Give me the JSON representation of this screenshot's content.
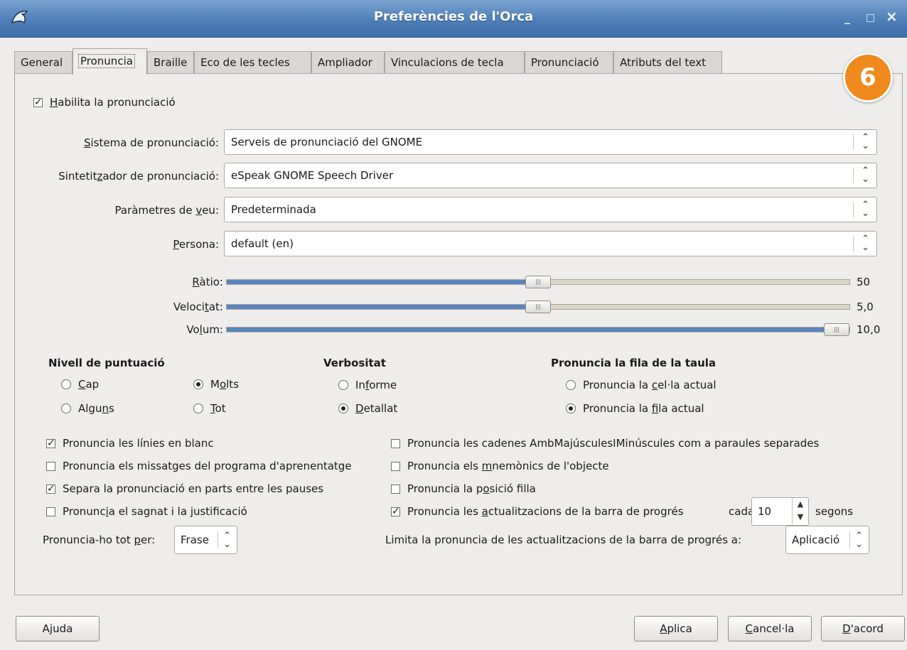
{
  "window": {
    "title": "Preferències de l'Orca",
    "minimize": "_",
    "maximize": "□",
    "close": "×"
  },
  "tabs": [
    "General",
    "Pronuncia",
    "Braille",
    "Eco de les tecles",
    "Ampliador",
    "Vinculacions de tecla",
    "Pronunciació",
    "Atributs del text"
  ],
  "badge": "6",
  "enable_speech": {
    "pre": "",
    "ul": "H",
    "post": "abilita la pronunciació",
    "checked": true
  },
  "fields": {
    "system": {
      "pre": "",
      "ul": "S",
      "post": "istema de pronunciació:",
      "value": "Serveis de pronunciació del GNOME"
    },
    "synth": {
      "pre": "Sintetit",
      "ul": "z",
      "post": "ador de pronunciació:",
      "value": "eSpeak GNOME Speech Driver"
    },
    "voice": {
      "pre": "Paràmetres de ",
      "ul": "v",
      "post": "eu:",
      "value": "Predeterminada"
    },
    "person": {
      "pre": "",
      "ul": "P",
      "post": "ersona:",
      "value": "default (en)"
    }
  },
  "sliders": {
    "rate": {
      "pre": "",
      "ul": "R",
      "post": "àtio:",
      "value": "50",
      "fraction": 0.5
    },
    "pitch": {
      "pre": "Veloci",
      "ul": "t",
      "post": "at:",
      "value": "5,0",
      "fraction": 0.5
    },
    "volume": {
      "pre": "Vo",
      "ul": "l",
      "post": "um:",
      "value": "10,0",
      "fraction": 1.0
    }
  },
  "punct": {
    "header": "Nivell de puntuació",
    "none": {
      "pre": "",
      "ul": "C",
      "post": "ap",
      "selected": false
    },
    "most": {
      "pre": "M",
      "ul": "o",
      "post": "lts",
      "selected": true
    },
    "some": {
      "pre": "Algu",
      "ul": "n",
      "post": "s",
      "selected": false
    },
    "all": {
      "pre": "",
      "ul": "T",
      "post": "ot",
      "selected": false
    }
  },
  "verbosity": {
    "header": "Verbositat",
    "brief": {
      "pre": "In",
      "ul": "f",
      "post": "orme",
      "selected": false
    },
    "verbose": {
      "pre": "",
      "ul": "D",
      "post": "etallat",
      "selected": true
    }
  },
  "table_row": {
    "header": "Pronuncia la fila de la taula",
    "cell": {
      "pre": "Pronuncia la ",
      "ul": "c",
      "post": "el·la actual",
      "selected": false
    },
    "row": {
      "pre": "Pronuncia la ",
      "ul": "f",
      "post": "ila actual",
      "selected": true
    }
  },
  "checks_left": {
    "blank": {
      "pre": "Pronuncia les línies en blanc",
      "ul": "",
      "post": "",
      "checked": true
    },
    "tutorial": {
      "pre": "Pronuncia els missatges del programa d'aprenentatge",
      "ul": "",
      "post": "",
      "checked": false
    },
    "pauses": {
      "pre": "Separa la pronunciació en parts entre les pauses",
      "ul": "",
      "post": "",
      "checked": true
    },
    "indent": {
      "pre": "Pronunc",
      "ul": "i",
      "post": "a el sagnat i la justificació",
      "checked": false
    }
  },
  "checks_right": {
    "camel": {
      "pre": "Pronuncia les cadenes AmbMajúsculesIMinúscules com a paraules separades",
      "ul": "",
      "post": "",
      "checked": false
    },
    "mnemonic": {
      "pre": "Pronuncia els ",
      "ul": "m",
      "post": "nemònics de l'objecte",
      "checked": false
    },
    "child_pos": {
      "pre": "Pronuncia la p",
      "ul": "o",
      "post": "sició filla",
      "checked": false
    },
    "progress": {
      "pre": "Pronuncia les ",
      "ul": "a",
      "post": "ctualitzacions de la barra de progrés",
      "checked": true
    }
  },
  "progress_interval": {
    "every": "cada",
    "value": "10",
    "unit": "segons"
  },
  "say_all": {
    "pre": "Pronuncia-ho tot ",
    "ul": "p",
    "post": "er:",
    "value": "Frase"
  },
  "progress_limit": {
    "label": "Limita la pronuncia de les actualitzacions de la barra de progrés a:",
    "value": "Aplicació"
  },
  "buttons": {
    "help": "Ajuda",
    "apply": {
      "pre": "",
      "ul": "A",
      "post": "plica"
    },
    "cancel": {
      "pre": "",
      "ul": "C",
      "post": "ancel·la"
    },
    "ok": {
      "pre": "",
      "ul": "D",
      "post": "'acord"
    }
  },
  "colors": {
    "title_bar": "#4f7fb8",
    "slider_fill": "#5a86bf",
    "badge": "#f08a1c"
  }
}
